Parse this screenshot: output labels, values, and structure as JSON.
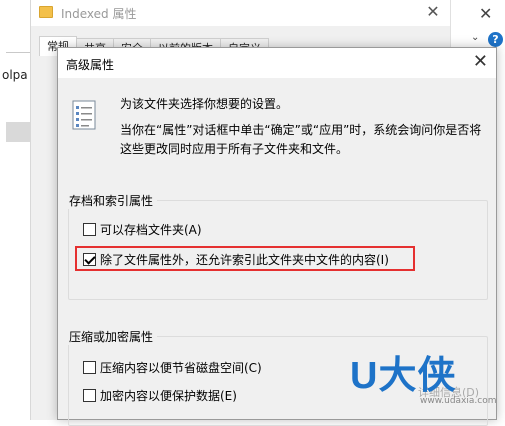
{
  "background_window": {
    "title": "Indexed 属性",
    "tabs": [
      "常规",
      "共享",
      "安全",
      "以前的版本",
      "自定义"
    ],
    "close_glyph": "✕"
  },
  "left_panel": {
    "text": "olpa"
  },
  "right_window": {
    "close_glyph": "✕",
    "chevron_glyph": "⌄",
    "help_glyph": "?"
  },
  "dialog": {
    "title": "高级属性",
    "close_glyph": "✕",
    "description_line1": "为该文件夹选择你想要的设置。",
    "description_line2": "当你在“属性”对话框中单击“确定”或“应用”时，系统会询问你是否将这些更改同时应用于所有子文件夹和文件。",
    "archive_group": {
      "label": "存档和索引属性",
      "options": [
        {
          "label": "可以存档文件夹(A)",
          "checked": false
        },
        {
          "label": "除了文件属性外，还允许索引此文件夹中文件的内容(I)",
          "checked": true
        }
      ]
    },
    "compress_group": {
      "label": "压缩或加密属性",
      "options": [
        {
          "label": "压缩内容以便节省磁盘空间(C)",
          "checked": false
        },
        {
          "label": "加密内容以便保护数据(E)",
          "checked": false
        }
      ]
    },
    "details_button": "详细信息(D)"
  },
  "watermark": {
    "brand": "U大侠",
    "url": "www.udaxia.com"
  },
  "colors": {
    "highlight": "#e53030",
    "brand_blue": "#1e73c8",
    "dialog_bg": "#f0f0f0"
  }
}
